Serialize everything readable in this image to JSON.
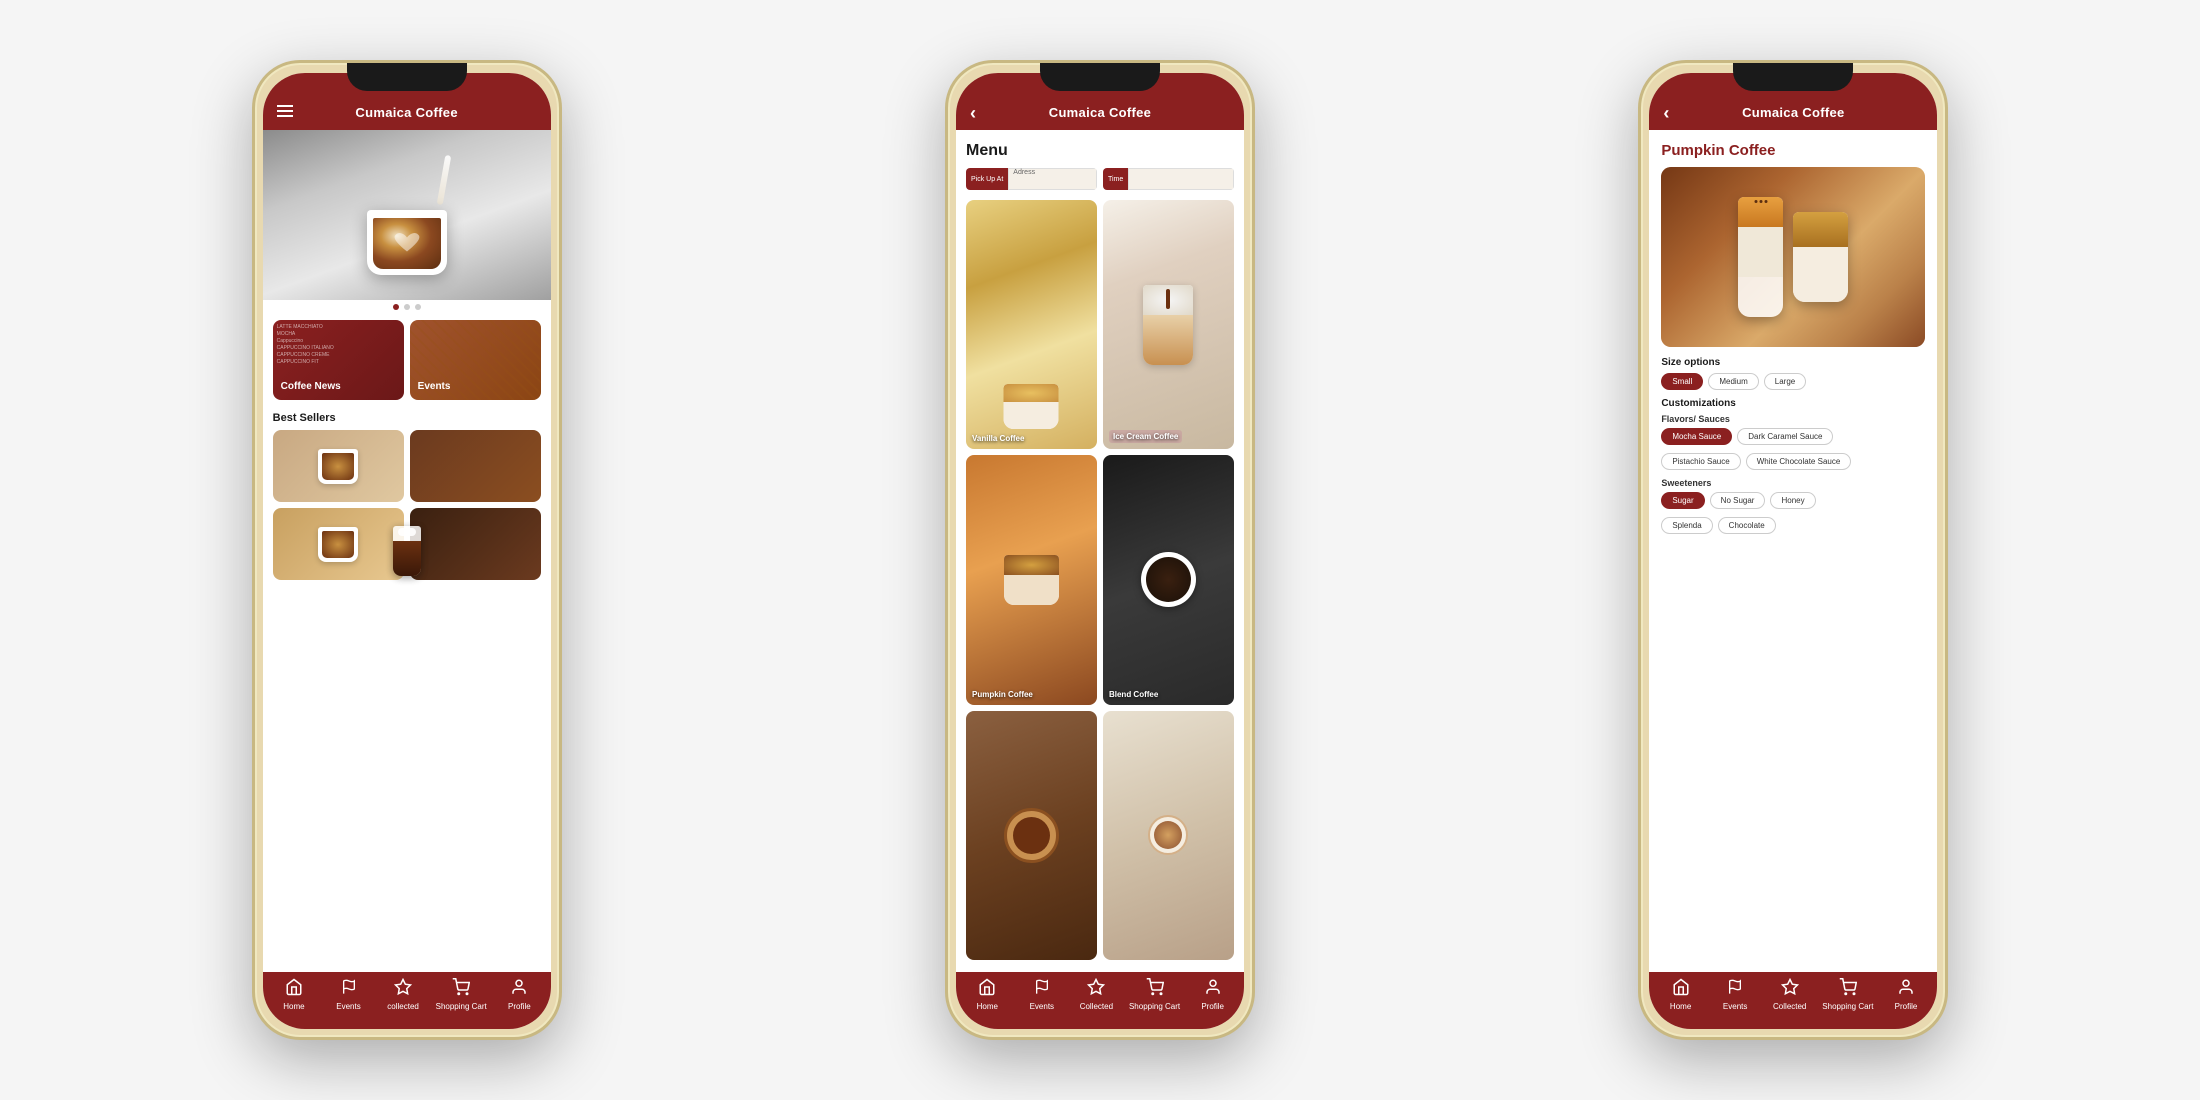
{
  "app": {
    "name": "Cumaica Coffee"
  },
  "phone1": {
    "header": {
      "title": "Cumaica Coffee"
    },
    "hero": {
      "carousel_dots": [
        "active",
        "inactive",
        "inactive"
      ]
    },
    "promo_cards": [
      {
        "id": "news",
        "label": "Coffee News"
      },
      {
        "id": "events",
        "label": "Events"
      }
    ],
    "bestsellers": {
      "title": "Best Sellers",
      "items": [
        {
          "id": "bs1",
          "alt": "Latte"
        },
        {
          "id": "bs2",
          "alt": "Iced Coffee"
        },
        {
          "id": "bs3",
          "alt": "Cold Brew"
        },
        {
          "id": "bs4",
          "alt": "Iced Latte"
        }
      ]
    },
    "nav": [
      {
        "id": "home",
        "icon": "⌂",
        "label": "Home"
      },
      {
        "id": "events",
        "icon": "⚑",
        "label": "Events"
      },
      {
        "id": "collected",
        "icon": "☆",
        "label": "collected"
      },
      {
        "id": "cart",
        "icon": "🛒",
        "label": "Shopping Cart"
      },
      {
        "id": "profile",
        "icon": "👤",
        "label": "Profile"
      }
    ]
  },
  "phone2": {
    "header": {
      "title": "Cumaica Coffee"
    },
    "menu": {
      "title": "Menu",
      "pickup_label": "Pick Up At",
      "pickup_placeholder": "Adress",
      "time_label": "Time",
      "time_placeholder": "",
      "items": [
        {
          "id": "vanilla",
          "label": "Vanilla Coffee"
        },
        {
          "id": "icecream",
          "label": "Ice Cream Coffee"
        },
        {
          "id": "pumpkin",
          "label": "Pumpkin Coffee"
        },
        {
          "id": "blend",
          "label": "Blend Coffee"
        },
        {
          "id": "tart",
          "label": ""
        },
        {
          "id": "latte",
          "label": ""
        }
      ]
    },
    "nav": [
      {
        "id": "home",
        "icon": "⌂",
        "label": "Home"
      },
      {
        "id": "events",
        "icon": "⚑",
        "label": "Events"
      },
      {
        "id": "collected",
        "icon": "☆",
        "label": "Collected"
      },
      {
        "id": "cart",
        "icon": "🛒",
        "label": "Shopping Cart"
      },
      {
        "id": "profile",
        "icon": "👤",
        "label": "Profile"
      }
    ]
  },
  "phone3": {
    "header": {
      "title": "Cumaica Coffee"
    },
    "product": {
      "title": "Pumpkin Coffee",
      "size_options_label": "Size options",
      "sizes": [
        {
          "id": "small",
          "label": "Small",
          "active": true
        },
        {
          "id": "medium",
          "label": "Medium",
          "active": false
        },
        {
          "id": "large",
          "label": "Large",
          "active": false
        }
      ],
      "customizations_label": "Customizations",
      "flavors_label": "Flavors/ Sauces",
      "sauces": [
        {
          "id": "mocha",
          "label": "Mocha Sauce",
          "active": true
        },
        {
          "id": "dark_caramel",
          "label": "Dark Caramel Sauce",
          "active": false
        },
        {
          "id": "pistachio",
          "label": "Pistachio Sauce",
          "active": false
        },
        {
          "id": "white_choc",
          "label": "White Chocolate Sauce",
          "active": false
        }
      ],
      "sweeteners_label": "Sweeteners",
      "sweeteners": [
        {
          "id": "sugar",
          "label": "Sugar",
          "active": true
        },
        {
          "id": "no_sugar",
          "label": "No Sugar",
          "active": false
        },
        {
          "id": "honey",
          "label": "Honey",
          "active": false
        },
        {
          "id": "splenda",
          "label": "Splenda",
          "active": false
        },
        {
          "id": "chocolate",
          "label": "Chocolate",
          "active": false
        }
      ]
    },
    "nav": [
      {
        "id": "home",
        "icon": "⌂",
        "label": "Home"
      },
      {
        "id": "events",
        "icon": "⚑",
        "label": "Events"
      },
      {
        "id": "collected",
        "icon": "☆",
        "label": "Collected"
      },
      {
        "id": "cart",
        "icon": "🛒",
        "label": "Shopping Cart"
      },
      {
        "id": "profile",
        "icon": "👤",
        "label": "Profile"
      }
    ]
  },
  "colors": {
    "brand_red": "#8b2020",
    "brand_brown": "#6b3a1f"
  }
}
